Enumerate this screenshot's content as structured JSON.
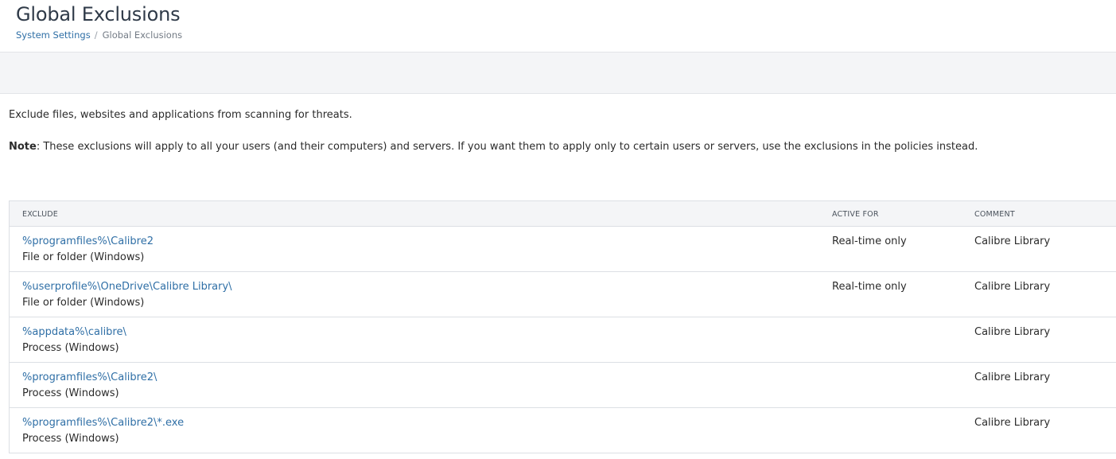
{
  "header": {
    "title": "Global Exclusions",
    "breadcrumb": {
      "parent": "System Settings",
      "separator": "/",
      "current": "Global Exclusions"
    }
  },
  "content": {
    "intro": "Exclude files, websites and applications from scanning for threats.",
    "note_label": "Note",
    "note_text": ": These exclusions will apply to all your users (and their computers) and servers. If you want them to apply only to certain users or servers, use the exclusions in the policies instead."
  },
  "table": {
    "columns": {
      "exclude": "EXCLUDE",
      "active_for": "ACTIVE FOR",
      "comment": "COMMENT"
    },
    "rows": [
      {
        "path": "%programfiles%\\Calibre2",
        "type": "File or folder (Windows)",
        "active_for": "Real-time only",
        "comment": "Calibre Library"
      },
      {
        "path": "%userprofile%\\OneDrive\\Calibre Library\\",
        "type": "File or folder (Windows)",
        "active_for": "Real-time only",
        "comment": "Calibre Library"
      },
      {
        "path": "%appdata%\\calibre\\",
        "type": "Process (Windows)",
        "active_for": "",
        "comment": "Calibre Library"
      },
      {
        "path": "%programfiles%\\Calibre2\\",
        "type": "Process (Windows)",
        "active_for": "",
        "comment": "Calibre Library"
      },
      {
        "path": "%programfiles%\\Calibre2\\*.exe",
        "type": "Process (Windows)",
        "active_for": "",
        "comment": "Calibre Library"
      }
    ]
  },
  "colors": {
    "link": "#2f6fa6",
    "band": "#f4f5f7",
    "border": "#dcdfe4"
  }
}
